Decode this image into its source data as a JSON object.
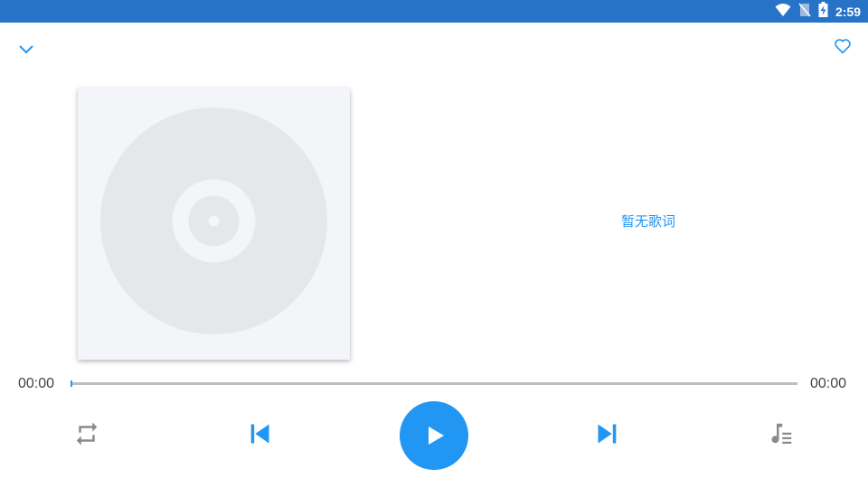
{
  "status_bar": {
    "time": "2:59",
    "background_color": "#2673c8",
    "icons": [
      "wifi-icon",
      "no-sim-icon",
      "battery-charging-icon"
    ]
  },
  "header": {
    "collapse_icon": "chevron-down-icon",
    "favorite_icon": "heart-outline-icon"
  },
  "album_art": {
    "icon": "disc-icon"
  },
  "lyrics": {
    "text": "暂无歌词"
  },
  "progress": {
    "current_time": "00:00",
    "total_time": "00:00",
    "fraction": 0
  },
  "controls": {
    "repeat_icon": "repeat-icon",
    "previous_icon": "skip-previous-icon",
    "play_icon": "play-icon",
    "next_icon": "skip-next-icon",
    "playlist_icon": "queue-music-icon"
  },
  "colors": {
    "accent": "#2196f3",
    "icon_gray": "#8a8a8a",
    "track": "#bdbdbd"
  }
}
